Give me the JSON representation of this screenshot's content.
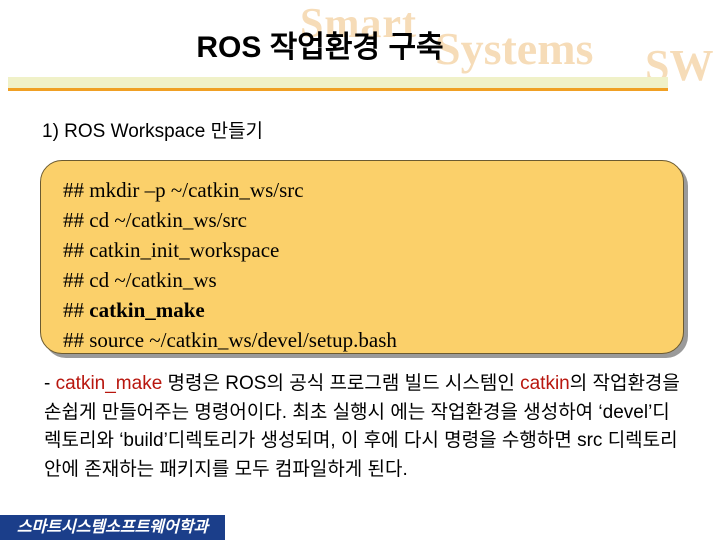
{
  "watermark": {
    "smart": "Smart",
    "systems": "Systems",
    "sw": "SW"
  },
  "slide": {
    "title": "ROS 작업환경 구축",
    "subtitle": "1) ROS Workspace 만들기"
  },
  "code_box": {
    "lines": [
      "## mkdir –p ~/catkin_ws/src",
      "## cd ~/catkin_ws/src",
      "## catkin_init_workspace",
      "## cd ~/catkin_ws",
      "## ",
      "## source ~/catkin_ws/devel/setup.bash"
    ],
    "bold_command": "catkin_make"
  },
  "description": {
    "prefix": "- ",
    "term1": "catkin_make",
    "part1": " 명령은 ROS의 공식 프로그램 빌드 시스템인 ",
    "term2": "catkin",
    "part2": "의 작업환경을 손쉽게 만들어주는 명령어이다. 최초 실행시 에는 작업환경을 생성하여 ‘devel’디렉토리와 ‘build’디렉토리가 생성되며, 이 후에 다시 명령을 수행하면 src 디렉토리안에 존재하는 패키지를 모두 컴파일하게 된다."
  },
  "footer": {
    "label": "스마트시스템소프트웨어학과"
  },
  "colors": {
    "code_box_bg": "#fbd06a",
    "highlight_red": "#b8160e",
    "footer_bg": "#1b3e8a",
    "title_rule": "#f0a024",
    "watermark": "#f6dcb8"
  }
}
